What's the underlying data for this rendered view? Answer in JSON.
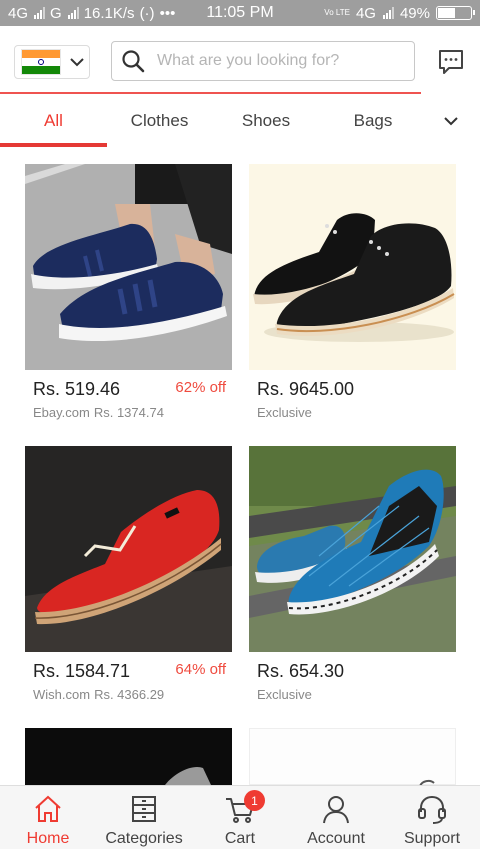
{
  "status_bar": {
    "network1": "4G",
    "network2": "G",
    "speed": "16.1K/s",
    "time": "11:05 PM",
    "network3": "4G",
    "volte": "Vo LTE",
    "battery": "49%",
    "battery_level": 0.49
  },
  "header": {
    "country_icon": "india-flag-icon",
    "search_placeholder": "What are you looking for?",
    "accent_color": "#ef3b32"
  },
  "tabs": [
    {
      "label": "All",
      "active": true
    },
    {
      "label": "Clothes"
    },
    {
      "label": "Shoes"
    },
    {
      "label": "Bags"
    }
  ],
  "products": [
    {
      "price": "Rs. 519.46",
      "discount": "62% off",
      "source": "Ebay.com",
      "original_price": "Rs. 1374.74"
    },
    {
      "price": "Rs. 9645.00",
      "discount": "",
      "source": "Exclusive",
      "original_price": ""
    },
    {
      "price": "Rs. 1584.71",
      "discount": "64% off",
      "source": "Wish.com",
      "original_price": "Rs. 4366.29"
    },
    {
      "price": "Rs. 654.30",
      "discount": "",
      "source": "Exclusive",
      "original_price": ""
    }
  ],
  "bottom_nav": [
    {
      "label": "Home",
      "icon": "home-icon",
      "active": true
    },
    {
      "label": "Categories",
      "icon": "categories-icon"
    },
    {
      "label": "Cart",
      "icon": "cart-icon",
      "badge": "1"
    },
    {
      "label": "Account",
      "icon": "account-icon"
    },
    {
      "label": "Support",
      "icon": "headset-icon"
    }
  ]
}
